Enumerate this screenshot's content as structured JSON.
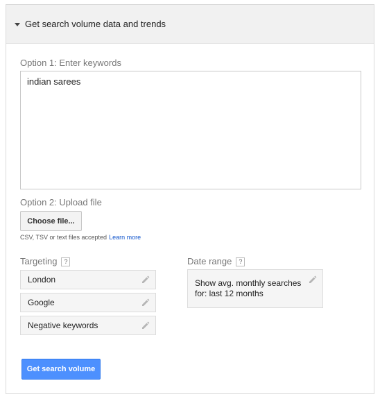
{
  "header": {
    "title": "Get search volume data and trends"
  },
  "option1": {
    "label": "Option 1: Enter keywords",
    "value": "indian sarees"
  },
  "option2": {
    "label": "Option 2: Upload file",
    "choose_label": "Choose file...",
    "hint": "CSV, TSV or text files accepted",
    "learn_more": "Learn more"
  },
  "targeting": {
    "label": "Targeting",
    "help": "?",
    "items": [
      {
        "label": "London"
      },
      {
        "label": "Google"
      },
      {
        "label": "Negative keywords"
      }
    ]
  },
  "date_range": {
    "label": "Date range",
    "help": "?",
    "line1": "Show avg. monthly searches",
    "line2": "for: last 12 months"
  },
  "submit": {
    "label": "Get search volume"
  },
  "colors": {
    "primary": "#4d90fe",
    "link": "#1155cc"
  }
}
